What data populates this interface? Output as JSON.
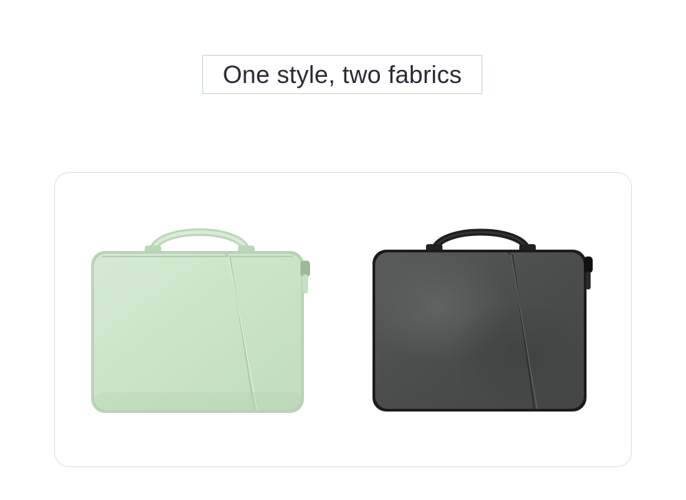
{
  "header": {
    "title": "One style, two fabrics"
  },
  "colors": {
    "title_border": "#b9d6bd",
    "title_text": "#2b2b33",
    "panel_border": "#dcdcdc",
    "green_fabric": "#cfe6cc",
    "gray_fabric": "#505251"
  },
  "products": [
    {
      "name": "green-sleeve-bag",
      "fabric_color": "#cfe6cc"
    },
    {
      "name": "gray-sleeve-bag",
      "fabric_color": "#505251"
    }
  ]
}
